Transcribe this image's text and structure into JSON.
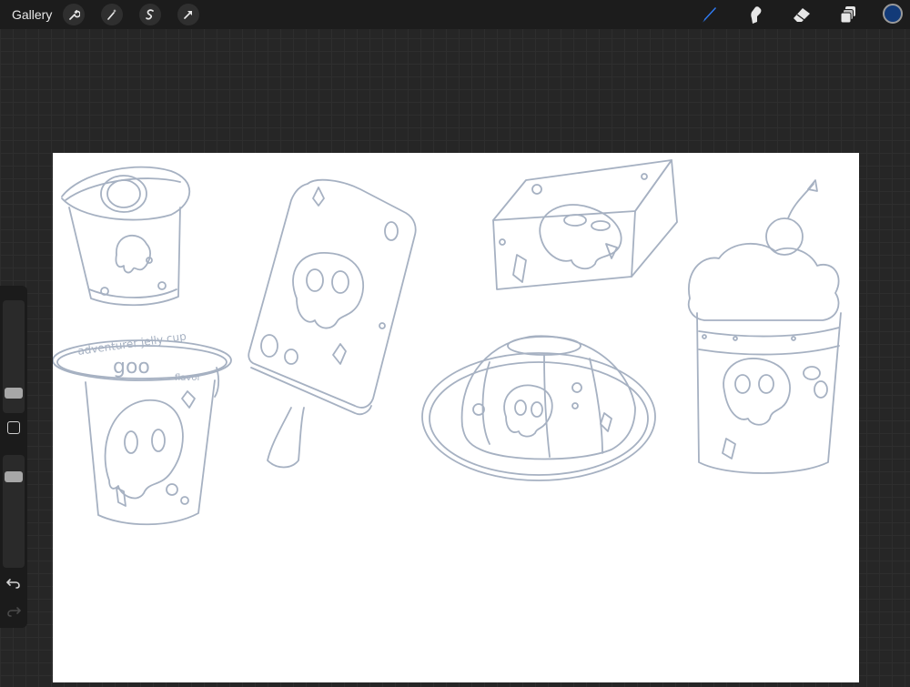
{
  "toolbar": {
    "gallery_label": "Gallery",
    "left_tools": [
      "wrench-icon",
      "magic-wand-icon",
      "selection-icon",
      "transform-icon"
    ],
    "right_tools": [
      "brush-icon",
      "smudge-icon",
      "eraser-icon",
      "layers-icon"
    ],
    "active_tool": "brush",
    "active_color": "#123a78",
    "active_tool_color": "#2f7cf6"
  },
  "sidebar": {
    "brush_size_level": 0.35,
    "opacity_level": 0.8,
    "controls": [
      "modify-button",
      "undo-icon",
      "redo-icon"
    ]
  },
  "canvas": {
    "background": "#ffffff",
    "sketch_color": "#a6b1c2",
    "drawings": [
      "pudding-cup",
      "jelly-cup",
      "popsicle",
      "cheese-wedge",
      "bundt-jelly",
      "sundae-cup"
    ],
    "jelly_cup_label": {
      "line1": "adventurer jelly cup",
      "line2": "goo",
      "line3": "flavor"
    }
  }
}
